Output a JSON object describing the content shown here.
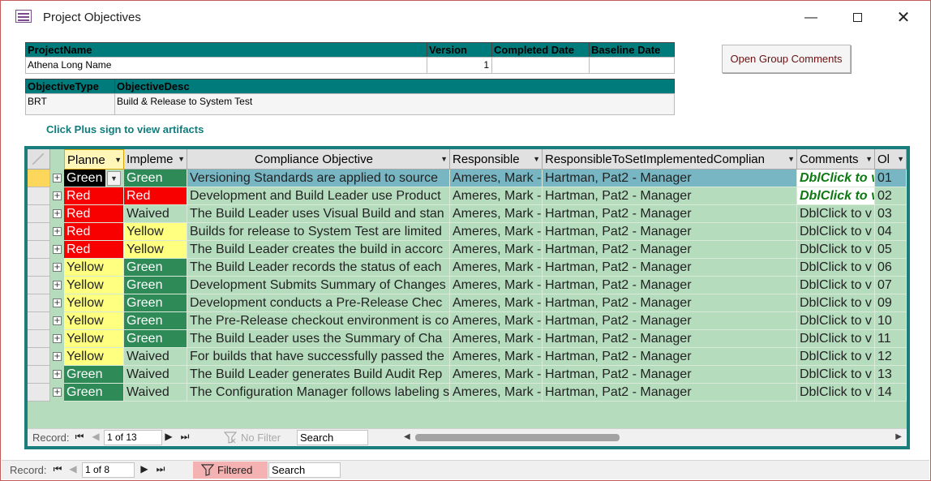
{
  "window": {
    "title": "Project Objectives",
    "min_glyph": "—",
    "close_glyph": "✕"
  },
  "header": {
    "project_name_label": "ProjectName",
    "version_label": "Version",
    "completed_date_label": "Completed Date",
    "baseline_date_label": "Baseline Date",
    "project_name": "Athena Long Name",
    "version": "1",
    "completed_date": "",
    "baseline_date": "",
    "objective_type_label": "ObjectiveType",
    "objective_desc_label": "ObjectiveDesc",
    "objective_type": "BRT",
    "objective_desc": "Build & Release to System Test"
  },
  "group_comments_button": "Open Group Comments",
  "hint": "Click Plus sign to view artifacts",
  "datasheet": {
    "columns": {
      "planned": "Planne",
      "implemented": "Impleme",
      "objective": "Compliance Objective",
      "responsible": "Responsible",
      "resp_set": "ResponsibleToSetImplementedComplian",
      "comments": "Comments",
      "ob": "Ol"
    },
    "rows": [
      {
        "planned": "Green",
        "implemented": "Green",
        "objective": "Versioning Standards are applied to source",
        "responsible": "Ameres, Mark -",
        "resp_set": "Hartman, Pat2 - Manager",
        "comments": "DblClick to v",
        "ob": "01",
        "selected": true,
        "comment_link": true
      },
      {
        "planned": "Red",
        "implemented": "Red",
        "objective": "Development and Build Leader use Product",
        "responsible": "Ameres, Mark -",
        "resp_set": "Hartman, Pat2 - Manager",
        "comments": "DblClick to v",
        "ob": "02",
        "comment_link": true
      },
      {
        "planned": "Red",
        "implemented": "Waived",
        "objective": "The Build Leader uses Visual Build and stan",
        "responsible": "Ameres, Mark -",
        "resp_set": "Hartman, Pat2 - Manager",
        "comments": "DblClick to v",
        "ob": "03"
      },
      {
        "planned": "Red",
        "implemented": "Yellow",
        "objective": "Builds for release to System Test are limited",
        "responsible": "Ameres, Mark -",
        "resp_set": "Hartman, Pat2 - Manager",
        "comments": "DblClick to v",
        "ob": "04"
      },
      {
        "planned": "Red",
        "implemented": "Yellow",
        "objective": "The Build Leader creates the build in accorc",
        "responsible": "Ameres, Mark -",
        "resp_set": "Hartman, Pat2 - Manager",
        "comments": "DblClick to v",
        "ob": "05"
      },
      {
        "planned": "Yellow",
        "implemented": "Green",
        "objective": "The Build Leader records the status of each",
        "responsible": "Ameres, Mark -",
        "resp_set": "Hartman, Pat2 - Manager",
        "comments": "DblClick to v",
        "ob": "06"
      },
      {
        "planned": "Yellow",
        "implemented": "Green",
        "objective": "Development Submits Summary of Changes",
        "responsible": "Ameres, Mark -",
        "resp_set": "Hartman, Pat2 - Manager",
        "comments": "DblClick to v",
        "ob": "07"
      },
      {
        "planned": "Yellow",
        "implemented": "Green",
        "objective": "Development conducts  a Pre-Release Chec",
        "responsible": "Ameres, Mark -",
        "resp_set": "Hartman, Pat2 - Manager",
        "comments": "DblClick to v",
        "ob": "09"
      },
      {
        "planned": "Yellow",
        "implemented": "Green",
        "objective": "The Pre-Release checkout environment is co",
        "responsible": "Ameres, Mark -",
        "resp_set": "Hartman, Pat2 - Manager",
        "comments": "DblClick to v",
        "ob": "10"
      },
      {
        "planned": "Yellow",
        "implemented": "Green",
        "objective": "The Build Leader uses the Summary of Cha",
        "responsible": "Ameres, Mark -",
        "resp_set": "Hartman, Pat2 - Manager",
        "comments": "DblClick to v",
        "ob": "11"
      },
      {
        "planned": "Yellow",
        "implemented": "Waived",
        "objective": "For builds that have successfully passed the",
        "responsible": "Ameres, Mark -",
        "resp_set": "Hartman, Pat2 - Manager",
        "comments": "DblClick to v",
        "ob": "12"
      },
      {
        "planned": "Green",
        "implemented": "Waived",
        "objective": "The Build Leader generates Build Audit Rep",
        "responsible": "Ameres, Mark -",
        "resp_set": "Hartman, Pat2 - Manager",
        "comments": "DblClick to v",
        "ob": "13"
      },
      {
        "planned": "Green",
        "implemented": "Waived",
        "objective": "The Configuration Manager follows labeling s",
        "responsible": "Ameres, Mark -",
        "resp_set": "Hartman, Pat2 - Manager",
        "comments": "DblClick to v",
        "ob": "14"
      }
    ],
    "footer": {
      "record_label": "Record:",
      "record_value": "1 of 13",
      "filter_label": "No Filter",
      "search_placeholder": "Search"
    }
  },
  "main_footer": {
    "record_label": "Record:",
    "record_value": "1 of 8",
    "filter_label": "Filtered",
    "search_placeholder": "Search"
  },
  "colors": {
    "header_teal": "#007b7b",
    "green_status": "#2e8b57",
    "red_status": "#f90000",
    "yellow_status": "#ffff80",
    "sheet_bg": "#b6dcbe",
    "selected_row": "#78b6c3"
  },
  "icons": [
    "form-icon",
    "minimize-icon",
    "maximize-icon",
    "close-icon",
    "expand-plus-icon",
    "dropdown-arrow-icon",
    "filter-funnel-icon",
    "first-record-icon",
    "prev-record-icon",
    "next-record-icon",
    "last-record-icon"
  ]
}
